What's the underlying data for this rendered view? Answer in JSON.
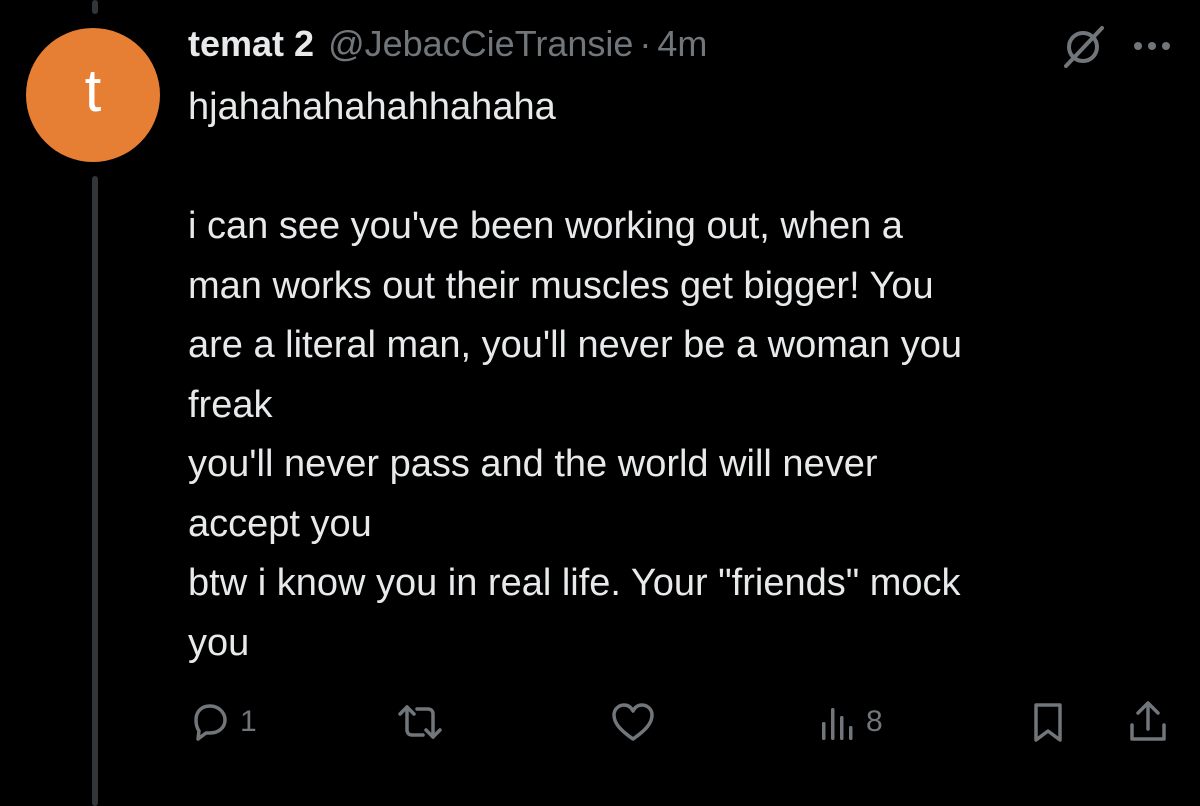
{
  "tweet": {
    "avatar_letter": "t",
    "avatar_color": "#e67e34",
    "display_name": "temat 2",
    "handle": "@JebacCieTransie",
    "separator": "·",
    "timestamp": "4m",
    "text": "hjahahahahahhahaha\n\ni can see you've been working out, when a\nman works out their muscles get bigger! You\nare a literal man, you'll never be a woman you\nfreak\nyou'll never pass and the world will never\naccept you\nbtw i know you in real life. Your \"friends\" mock\nyou"
  },
  "header_icons": {
    "grok": "grok-icon",
    "more": "more-options-icon"
  },
  "actions": {
    "reply": {
      "icon": "reply-icon",
      "count": "1"
    },
    "repost": {
      "icon": "repost-icon"
    },
    "like": {
      "icon": "heart-icon"
    },
    "views": {
      "icon": "analytics-icon",
      "count": "8"
    },
    "bookmark": {
      "icon": "bookmark-icon"
    },
    "share": {
      "icon": "share-icon"
    }
  },
  "colors": {
    "background": "#000000",
    "text_primary": "#e7e9ea",
    "text_secondary": "#71767b",
    "thread_line": "#333639"
  }
}
